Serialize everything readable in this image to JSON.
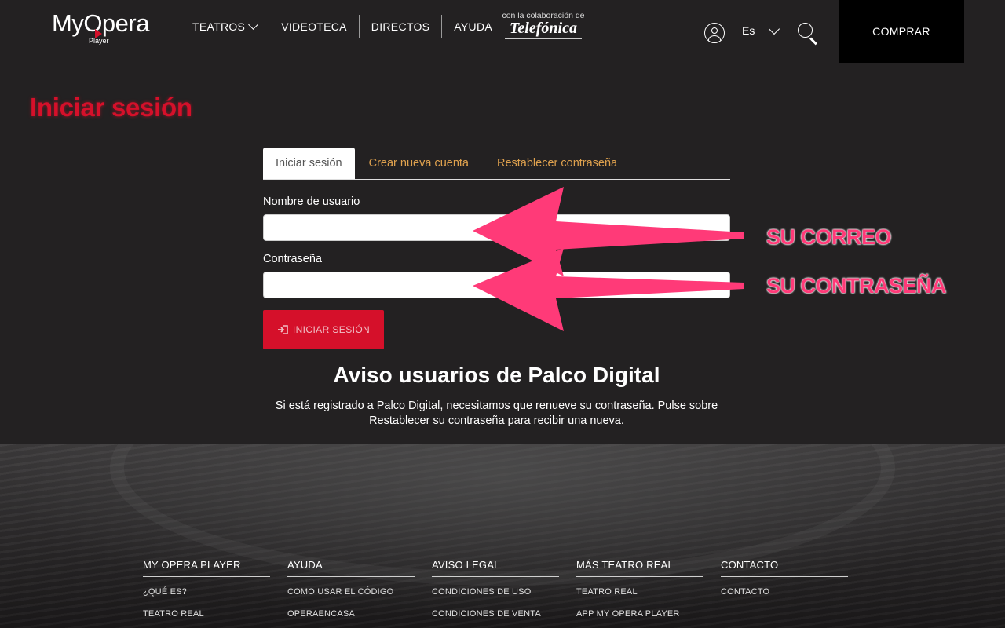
{
  "header": {
    "logo_text": "MyOpera",
    "logo_sub": "Player",
    "nav": [
      {
        "label": "TEATROS",
        "has_dropdown": true
      },
      {
        "label": "VIDEOTECA"
      },
      {
        "label": "DIRECTOS"
      },
      {
        "label": "AYUDA"
      }
    ],
    "collab_small": "con la colaboración de",
    "collab_brand": "Telefónica",
    "language": "Es",
    "buy_label": "COMPRAR"
  },
  "page": {
    "title": "Iniciar sesión"
  },
  "tabs": [
    {
      "label": "Iniciar sesión",
      "active": true
    },
    {
      "label": "Crear nueva cuenta"
    },
    {
      "label": "Restablecer contraseña"
    }
  ],
  "form": {
    "username_label": "Nombre de usuario",
    "username_value": "",
    "password_label": "Contraseña",
    "password_value": "",
    "submit_label": "INICIAR SESIÓN"
  },
  "notice": {
    "title": "Aviso usuarios de Palco Digital",
    "text": "Si está registrado a Palco Digital, necesitamos que renueve su contraseña. Pulse sobre Restablecer su contraseña para recibir una nueva."
  },
  "annotations": {
    "email": "SU CORREO",
    "password": "SU CONTRASEÑA",
    "color": "#ff3a78"
  },
  "footer": {
    "columns": [
      {
        "title": "MY OPERA PLAYER",
        "links": [
          "¿QUÉ ES?",
          "TEATRO REAL"
        ]
      },
      {
        "title": "AYUDA",
        "links": [
          "COMO USAR EL CÓDIGO",
          "OPERAENCASA"
        ]
      },
      {
        "title": "AVISO LEGAL",
        "links": [
          "CONDICIONES DE USO",
          "CONDICIONES DE VENTA"
        ]
      },
      {
        "title": "MÁS TEATRO REAL",
        "links": [
          "TEATRO REAL",
          "APP MY OPERA PLAYER"
        ]
      },
      {
        "title": "CONTACTO",
        "links": [
          "CONTACTO"
        ]
      }
    ]
  },
  "colors": {
    "background": "#232122",
    "accent": "#d5102a",
    "tab_link": "#e0a24e"
  }
}
